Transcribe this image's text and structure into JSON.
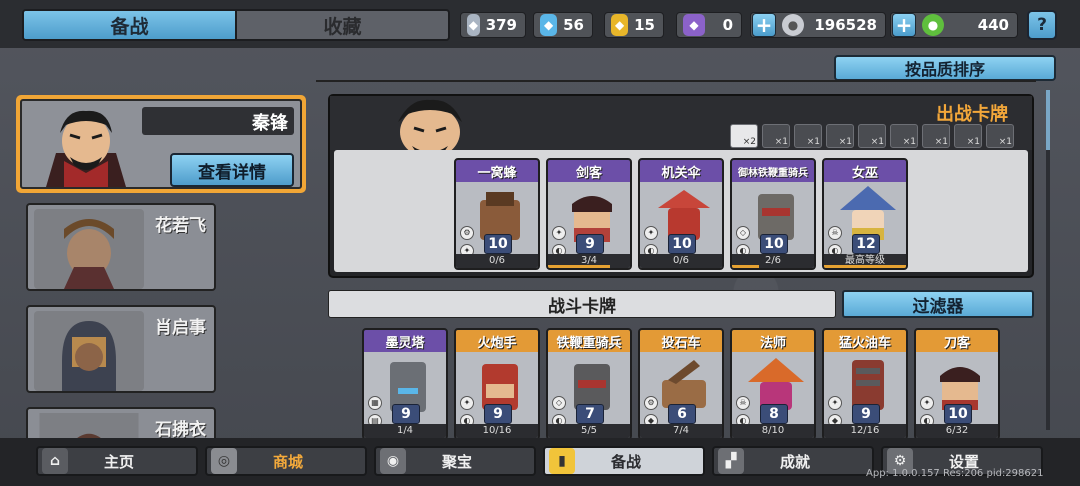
{
  "tabs": {
    "prepare": "备战",
    "collect": "收藏"
  },
  "resources": [
    {
      "icon": "silver-shield-icon",
      "value": "379",
      "color": "#a9b4c2"
    },
    {
      "icon": "blue-crystal-icon",
      "value": "56",
      "color": "#5ab6e8"
    },
    {
      "icon": "gold-shield-icon",
      "value": "15",
      "color": "#e8b62a"
    },
    {
      "icon": "purple-shield-icon",
      "value": "0",
      "color": "#8b62c9"
    }
  ],
  "currency": {
    "silver": "196528",
    "jade": "440"
  },
  "help": "?",
  "sort_label": "按品质排序",
  "heroes": {
    "selected": "秦锋",
    "detail_btn": "查看详情",
    "list": [
      "花若飞",
      "肖启事",
      "石拂衣"
    ]
  },
  "deck": {
    "title": "出战卡牌",
    "slots": [
      "×2",
      "×1",
      "×1",
      "×1",
      "×1",
      "×1",
      "×1",
      "×1",
      "×1"
    ],
    "cards": [
      {
        "name": "一窝蜂",
        "level": "10",
        "count": "0/6",
        "rarity": "purple",
        "art": "#8a5b3a"
      },
      {
        "name": "剑客",
        "level": "9",
        "count": "3/4",
        "rarity": "purple",
        "art": "#b2413a"
      },
      {
        "name": "机关伞",
        "level": "10",
        "count": "0/6",
        "rarity": "purple",
        "art": "#c8463a"
      },
      {
        "name": "御林铁鞭重骑兵",
        "level": "10",
        "count": "2/6",
        "rarity": "purple",
        "art": "#6d6a66"
      },
      {
        "name": "女巫",
        "level": "12",
        "count": "最高等级",
        "rarity": "purple",
        "art": "#4b6ab0"
      }
    ]
  },
  "battle": {
    "title": "战斗卡牌",
    "filter": "过滤器",
    "cards": [
      {
        "name": "墨灵塔",
        "level": "9",
        "count": "1/4",
        "rarity": "purple",
        "art": "#6b6f75"
      },
      {
        "name": "火炮手",
        "level": "9",
        "count": "10/16",
        "rarity": "orange",
        "art": "#b23a2e"
      },
      {
        "name": "铁鞭重骑兵",
        "level": "7",
        "count": "5/5",
        "rarity": "orange",
        "art": "#5a5a5c"
      },
      {
        "name": "投石车",
        "level": "6",
        "count": "7/4",
        "rarity": "orange",
        "art": "#9a6c45"
      },
      {
        "name": "法师",
        "level": "8",
        "count": "8/10",
        "rarity": "orange",
        "art": "#d96a2a"
      },
      {
        "name": "猛火油车",
        "level": "9",
        "count": "12/16",
        "rarity": "orange",
        "art": "#8a3b30"
      },
      {
        "name": "刀客",
        "level": "10",
        "count": "6/32",
        "rarity": "orange",
        "art": "#a8372e"
      }
    ]
  },
  "nav": [
    {
      "label": "主页",
      "icon": "home-icon"
    },
    {
      "label": "商城",
      "icon": "coins-icon"
    },
    {
      "label": "聚宝",
      "icon": "treasure-icon"
    },
    {
      "label": "备战",
      "icon": "cards-icon"
    },
    {
      "label": "成就",
      "icon": "achievement-icon"
    },
    {
      "label": "设置",
      "icon": "gear-icon"
    }
  ],
  "version": "App: 1.0.0.157 Res:206 pid:298621"
}
